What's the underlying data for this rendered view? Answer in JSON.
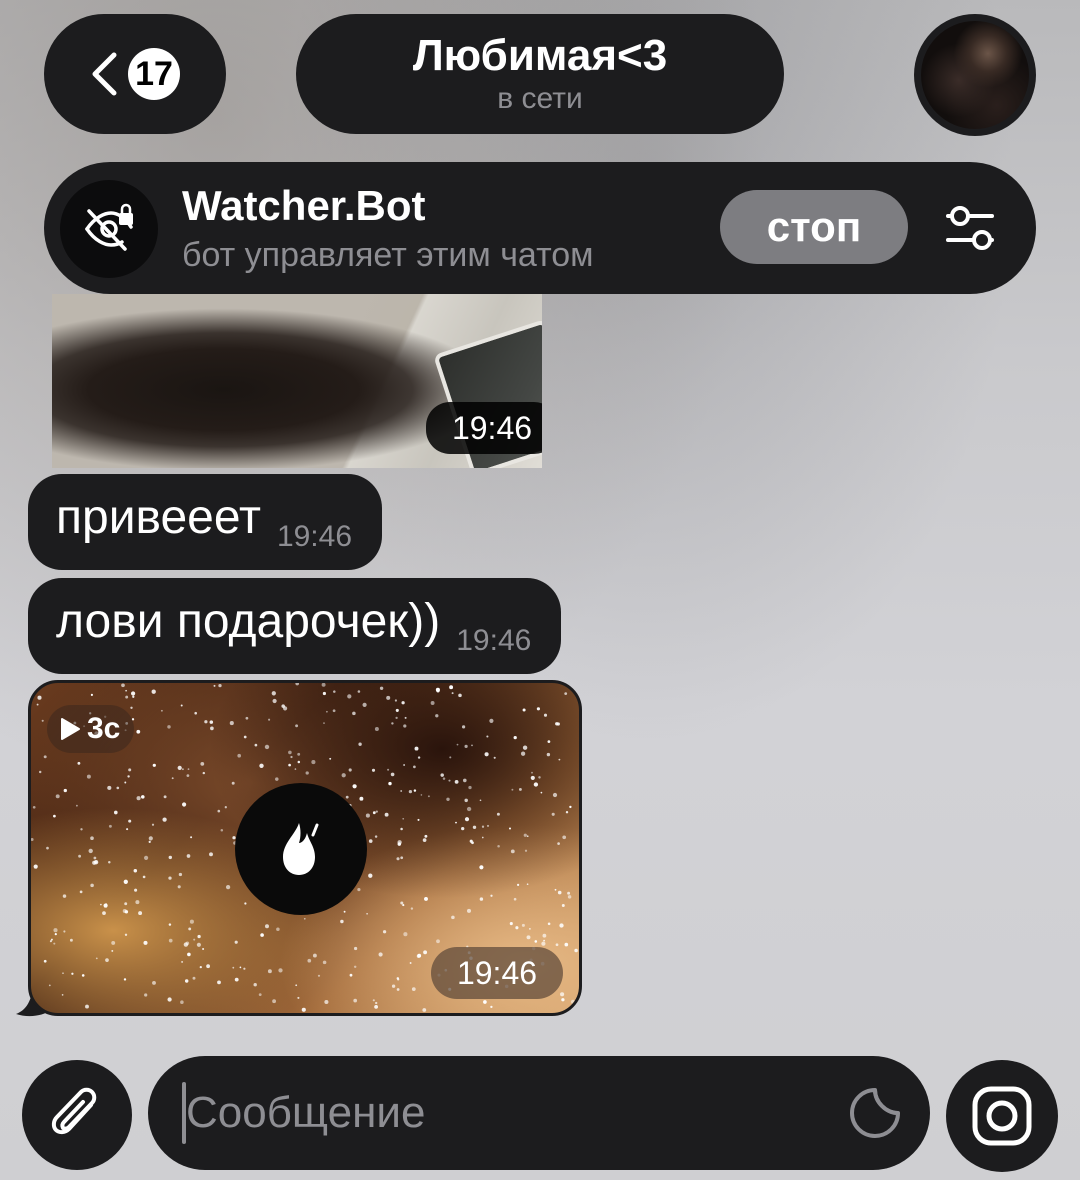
{
  "header": {
    "back_count": "17",
    "chat_title": "Любимая<3",
    "chat_status": "в сети"
  },
  "bot_banner": {
    "name": "Watcher.Bot",
    "description": "бот управляет этим чатом",
    "stop_label": "стоп"
  },
  "messages": [
    {
      "type": "photo",
      "time": "19:46"
    },
    {
      "type": "text",
      "text": "привееет",
      "time": "19:46"
    },
    {
      "type": "text",
      "text": "лови подарочек))",
      "time": "19:46"
    },
    {
      "type": "video",
      "duration": "3с",
      "time": "19:46"
    }
  ],
  "composer": {
    "placeholder": "Сообщение"
  },
  "icons": {
    "back": "chevron-left-icon",
    "bot": "eye-slash-lock-icon",
    "settings": "sliders-icon",
    "play": "play-icon",
    "fire": "fire-icon",
    "attach": "paperclip-icon",
    "sticker": "sticker-icon",
    "camera": "camera-icon"
  },
  "colors": {
    "bubble": "#1c1c1e",
    "secondary_text": "#8e8e93",
    "stop_button": "#7d7d81"
  }
}
